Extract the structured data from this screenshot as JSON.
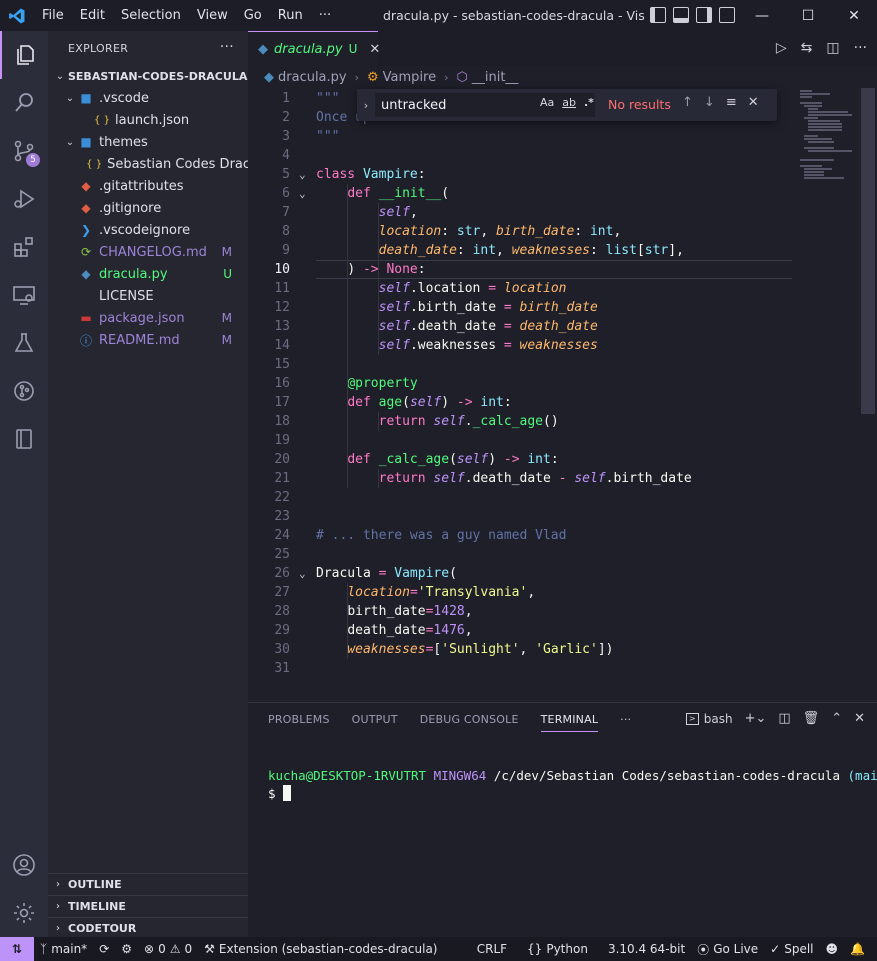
{
  "titlebar": {
    "menu": [
      "File",
      "Edit",
      "Selection",
      "View",
      "Go",
      "Run",
      "···"
    ],
    "title": "dracula.py - sebastian-codes-dracula - Visual Studio Code"
  },
  "activity": {
    "items": [
      "explorer-icon",
      "search-icon",
      "source-control-icon",
      "run-debug-icon",
      "extensions-icon",
      "remote-explorer-icon",
      "testing-icon",
      "git-graph-icon",
      "notebook-icon"
    ],
    "scm_badge": "5",
    "bottom": [
      "account-icon",
      "manage-gear-icon"
    ]
  },
  "sidebar": {
    "header": "EXPLORER",
    "project": "SEBASTIAN-CODES-DRACULA",
    "tree": [
      {
        "label": ".vscode",
        "type": "folder-open",
        "indent": 1,
        "icon": "vscode-folder-icon",
        "color": "#e0e0e8",
        "status": ""
      },
      {
        "label": "launch.json",
        "type": "file",
        "indent": 2,
        "icon": "json-icon",
        "color": "#e0e0e8",
        "status": ""
      },
      {
        "label": "themes",
        "type": "folder-open",
        "indent": 1,
        "icon": "folder-icon",
        "color": "#e0e0e8",
        "status": ""
      },
      {
        "label": "Sebastian Codes Dracula-color-theme.json",
        "type": "file",
        "indent": 2,
        "icon": "json-icon",
        "color": "#e0e0e8",
        "status": ""
      },
      {
        "label": ".gitattributes",
        "type": "file",
        "indent": 1,
        "icon": "git-icon",
        "color": "#e0e0e8",
        "status": ""
      },
      {
        "label": ".gitignore",
        "type": "file",
        "indent": 1,
        "icon": "git-icon",
        "color": "#e0e0e8",
        "status": ""
      },
      {
        "label": ".vscodeignore",
        "type": "file",
        "indent": 1,
        "icon": "vscode-icon",
        "color": "#e0e0e8",
        "status": ""
      },
      {
        "label": "CHANGELOG.md",
        "type": "file",
        "indent": 1,
        "icon": "history-icon",
        "color": "#9d84d8",
        "status": "M"
      },
      {
        "label": "dracula.py",
        "type": "file",
        "indent": 1,
        "icon": "python-icon",
        "color": "#50fa7b",
        "status": "U"
      },
      {
        "label": "LICENSE",
        "type": "file",
        "indent": 1,
        "icon": "license-icon",
        "color": "#e0e0e8",
        "status": ""
      },
      {
        "label": "package.json",
        "type": "file",
        "indent": 1,
        "icon": "npm-icon",
        "color": "#9d84d8",
        "status": "M"
      },
      {
        "label": "README.md",
        "type": "file",
        "indent": 1,
        "icon": "info-icon",
        "color": "#9d84d8",
        "status": "M"
      }
    ],
    "sections": [
      "OUTLINE",
      "TIMELINE",
      "CODETOUR"
    ]
  },
  "editor": {
    "tab_label": "dracula.py",
    "tab_status": "U",
    "breadcrumb": [
      "dracula.py",
      "Vampire",
      "__init__"
    ],
    "current_line": 10,
    "find": {
      "query": "untracked",
      "case_label": "Aa",
      "word_label": "ab",
      "regex_label": ".*",
      "result": "No results"
    },
    "lines": [
      "\"\"\"",
      "Once upon a time...",
      "\"\"\"",
      "",
      "class Vampire:",
      "    def __init__(",
      "        self,",
      "        location: str, birth_date: int,",
      "        death_date: int, weaknesses: list[str],",
      "    ) -> None:",
      "        self.location = location",
      "        self.birth_date = birth_date",
      "        self.death_date = death_date",
      "        self.weaknesses = weaknesses",
      "",
      "    @property",
      "    def age(self) -> int:",
      "        return self._calc_age()",
      "",
      "    def _calc_age(self) -> int:",
      "        return self.death_date - self.birth_date",
      "",
      "",
      "# ... there was a guy named Vlad",
      "",
      "Dracula = Vampire(",
      "    location='Transylvania',",
      "    birth_date=1428,",
      "    death_date=1476,",
      "    weaknesses=['Sunlight', 'Garlic'])",
      ""
    ]
  },
  "panel": {
    "tabs": [
      "PROBLEMS",
      "OUTPUT",
      "DEBUG CONSOLE",
      "TERMINAL"
    ],
    "active_tab": "TERMINAL",
    "shell": "bash",
    "terminal": {
      "user": "kucha@DESKTOP-1RVUTRT",
      "system": "MINGW64",
      "path": "/c/dev/Sebastian Codes/sebastian-codes-dracula",
      "branch": "(main)",
      "prompt": "$"
    }
  },
  "statusbar": {
    "branch": "main*",
    "errors": "0",
    "warnings": "0",
    "extension": "Extension (sebastian-codes-dracula)",
    "eol": "CRLF",
    "language": "Python",
    "interpreter": "3.10.4 64-bit",
    "golive": "Go Live",
    "spell": "Spell"
  },
  "colors": {
    "accent": "#bd93f9",
    "background": "#1e1f29",
    "sidebar": "#25262f",
    "activitybar": "#2c2d3a"
  }
}
